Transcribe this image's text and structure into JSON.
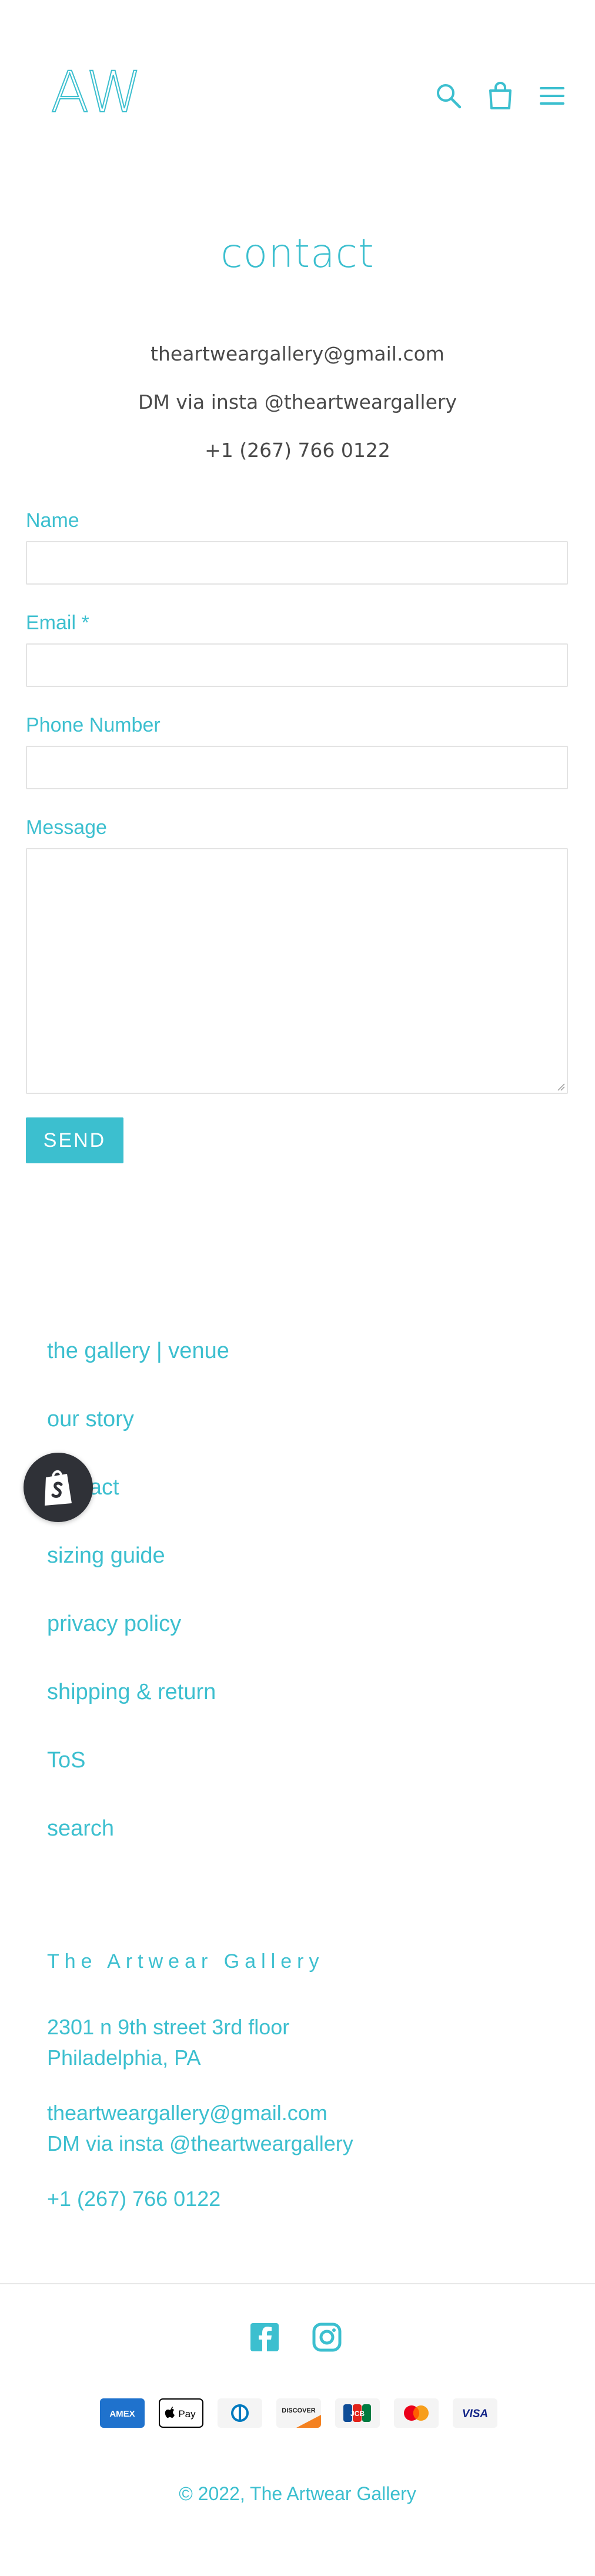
{
  "header": {
    "logo_text": "AW",
    "icons": [
      "search-icon",
      "cart-icon",
      "menu-icon"
    ]
  },
  "page": {
    "title": "contact",
    "email": "theartweargallery@gmail.com",
    "insta": "DM via insta @theartweargallery",
    "phone": "+1 (267) 766 0122"
  },
  "form": {
    "name_label": "Name",
    "email_label": "Email *",
    "phone_label": "Phone Number",
    "message_label": "Message",
    "name_value": "",
    "email_value": "",
    "phone_value": "",
    "message_value": "",
    "send_label": "SEND"
  },
  "footer": {
    "links": [
      "the gallery | venue",
      "our story",
      "contact",
      "sizing guide",
      "privacy policy",
      "shipping & return",
      "ToS",
      "search"
    ],
    "store_name": "The Artwear Gallery",
    "address_line1": "2301 n 9th street 3rd floor",
    "address_line2": "Philadelphia, PA",
    "email": "theartweargallery@gmail.com",
    "insta": "DM via insta @theartweargallery",
    "phone": "+1 (267) 766 0122",
    "social_icons": [
      "facebook-icon",
      "instagram-icon"
    ],
    "payment_icons": [
      "amex",
      "apple-pay",
      "diners-club",
      "discover",
      "jcb",
      "mastercard",
      "visa"
    ],
    "copyright": "© 2022, The Artwear Gallery"
  },
  "colors": {
    "accent": "#3cbfcf",
    "text": "#4a4a4a",
    "badge": "#2f3137"
  }
}
